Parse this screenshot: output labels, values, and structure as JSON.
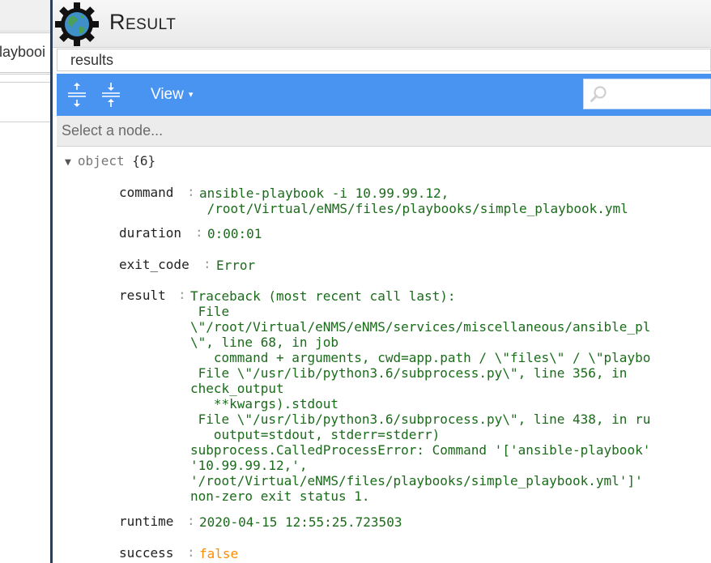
{
  "background_window": {
    "tab_label": "laybooi"
  },
  "window": {
    "title": "Result"
  },
  "name_field": {
    "value": "results"
  },
  "toolbar": {
    "expand_icon": "expand-all-icon",
    "collapse_icon": "collapse-all-icon",
    "view_label": "View",
    "view_caret": "▾",
    "search_placeholder": ""
  },
  "node_selector": {
    "placeholder": "Select a node..."
  },
  "tree": {
    "root_label": "object",
    "root_count": "{6}",
    "properties": [
      {
        "key": "command",
        "value": "ansible-playbook -i 10.99.99.12,\n /root/Virtual/eNMS/files/playbooks/simple_playbook.yml"
      },
      {
        "key": "duration",
        "value": "0:00:01"
      },
      {
        "key": "exit_code",
        "value": "Error"
      },
      {
        "key": "result",
        "value": "Traceback (most recent call last):\n File\n\\\"/root/Virtual/eNMS/eNMS/services/miscellaneous/ansible_pl\n\\\", line 68, in job\n   command + arguments, cwd=app.path / \\\"files\\\" / \\\"playbo\n File \\\"/usr/lib/python3.6/subprocess.py\\\", line 356, in\ncheck_output\n   **kwargs).stdout\n File \\\"/usr/lib/python3.6/subprocess.py\\\", line 438, in ru\n   output=stdout, stderr=stderr)\nsubprocess.CalledProcessError: Command '['ansible-playbook'\n'10.99.99.12,',\n'/root/Virtual/eNMS/files/playbooks/simple_playbook.yml']'\nnon-zero exit status 1."
      },
      {
        "key": "runtime",
        "value": "2020-04-15 12:55:25.723503"
      },
      {
        "key": "success",
        "value": "false"
      }
    ]
  },
  "colors": {
    "toolbar": "#4a94f1",
    "value_text": "#1a6b1a",
    "boolean_text": "#ff8c00",
    "panel_border": "#2b3f56"
  }
}
